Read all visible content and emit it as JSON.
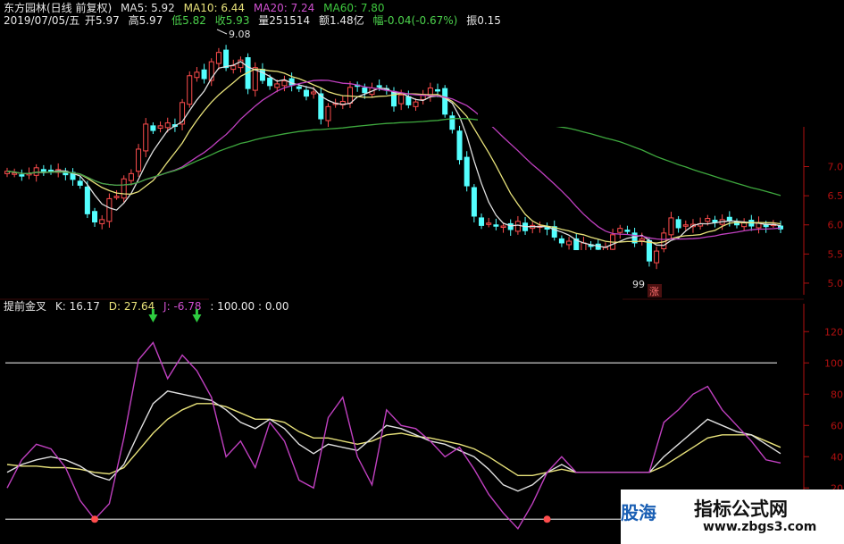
{
  "header": {
    "stock": "东方园林(日线 前复权)",
    "ma5": "MA5: 5.92",
    "ma10": "MA10: 6.44",
    "ma20": "MA20: 7.24",
    "ma60": "MA60: 7.80",
    "date": "2019/07/05/五",
    "open": "开5.97",
    "high": "高5.97",
    "low": "低5.82",
    "close": "收5.93",
    "volume": "量251514",
    "amount": "额1.48亿",
    "change": "幅-0.04(-0.67%)",
    "amplitude": "振0.15"
  },
  "indicator": {
    "name": "提前金叉",
    "k": "K: 16.17",
    "d": "D: 27.64",
    "j": "J: -6.78",
    "refs": ": 100.00 : 0.00"
  },
  "annotations": {
    "peak_label": "9.08",
    "low_label": "99",
    "rise_tag": "涨"
  },
  "watermark": {
    "left": "股海",
    "title": "指标公式网",
    "url": "www.zbgs3.com"
  },
  "colors": {
    "up": "#ff4d4d",
    "down": "#54ffff",
    "ma5": "#e0e0e0",
    "ma10": "#e8e27a",
    "ma20": "#c040c0",
    "ma60": "#3ea83e",
    "k": "#e0e0e0",
    "d": "#e8e27a",
    "j": "#c040c0",
    "axis": "#b01010"
  },
  "chart_data": [
    {
      "type": "candlestick",
      "y_ticks": [
        "7.0",
        "6.5",
        "6.0",
        "5.5",
        "5.0"
      ],
      "ylim": [
        4.8,
        9.4
      ],
      "close": [
        6.92,
        6.89,
        6.84,
        6.88,
        6.98,
        6.9,
        6.93,
        6.95,
        6.86,
        6.78,
        6.68,
        6.19,
        6.05,
        6.09,
        6.45,
        6.49,
        6.79,
        6.88,
        7.3,
        7.73,
        7.62,
        7.7,
        7.75,
        7.69,
        8.1,
        8.56,
        8.62,
        8.51,
        8.8,
        8.96,
        8.7,
        8.73,
        8.83,
        8.34,
        8.7,
        8.48,
        8.39,
        8.42,
        8.47,
        8.4,
        8.34,
        8.21,
        8.28,
        7.82,
        8.03,
        8.09,
        8.12,
        8.36,
        8.38,
        8.27,
        8.35,
        8.37,
        8.32,
        8.04,
        8.23,
        8.06,
        8.11,
        8.24,
        8.35,
        8.3,
        7.9,
        7.64,
        7.12,
        6.67,
        6.15,
        5.99,
        6.03,
        5.99,
        5.98,
        5.92,
        6.06,
        5.9,
        5.99,
        5.98,
        5.93,
        5.79,
        5.69,
        5.72,
        5.56,
        5.69,
        5.63,
        5.58,
        5.61,
        5.83,
        5.94,
        5.89,
        5.69,
        5.76,
        5.38,
        5.55,
        5.86,
        6.12,
        5.95,
        6.0,
        6.01,
        6.02,
        6.11,
        6.04,
        6.09,
        6.08,
        6.0,
        6.04,
        5.98,
        6.04,
        5.97,
        6.01,
        5.93
      ],
      "series_names": [
        "MA5",
        "MA10",
        "MA20",
        "MA60"
      ],
      "peak": 9.08
    },
    {
      "type": "line",
      "name": "提前金叉",
      "series_names": [
        "K",
        "D",
        "J"
      ],
      "y_ticks": [
        "120",
        "100",
        "80",
        "60",
        "40",
        "20"
      ],
      "ylim": [
        -5,
        135
      ],
      "ref_lines": [
        100,
        0
      ],
      "k": [
        30,
        35,
        38,
        40,
        38,
        34,
        28,
        25,
        35,
        55,
        74,
        82,
        80,
        78,
        76,
        70,
        62,
        58,
        64,
        58,
        48,
        42,
        48,
        46,
        44,
        52,
        60,
        58,
        54,
        50,
        48,
        44,
        40,
        32,
        22,
        18,
        22,
        30,
        35,
        30,
        30,
        30,
        30,
        30,
        30,
        40,
        48,
        56,
        64,
        60,
        56,
        54,
        48,
        42
      ],
      "d": [
        35,
        34,
        34,
        33,
        33,
        32,
        30,
        29,
        33,
        44,
        55,
        64,
        70,
        74,
        74,
        72,
        68,
        64,
        64,
        62,
        56,
        52,
        52,
        50,
        48,
        50,
        54,
        55,
        53,
        52,
        50,
        48,
        45,
        40,
        34,
        28,
        28,
        30,
        32,
        30,
        30,
        30,
        30,
        30,
        30,
        34,
        40,
        46,
        52,
        54,
        54,
        54,
        50,
        46
      ],
      "j": [
        20,
        38,
        48,
        45,
        33,
        12,
        0,
        10,
        52,
        102,
        113,
        90,
        105,
        95,
        78,
        40,
        50,
        33,
        62,
        50,
        25,
        20,
        65,
        78,
        40,
        22,
        70,
        60,
        58,
        50,
        40,
        46,
        32,
        16,
        4,
        -6,
        10,
        30,
        40,
        30,
        30,
        30,
        30,
        30,
        30,
        62,
        70,
        80,
        85,
        70,
        60,
        50,
        38,
        36
      ],
      "buy_arrows": [
        10,
        13
      ],
      "cross_marks": [
        6,
        37
      ]
    }
  ]
}
